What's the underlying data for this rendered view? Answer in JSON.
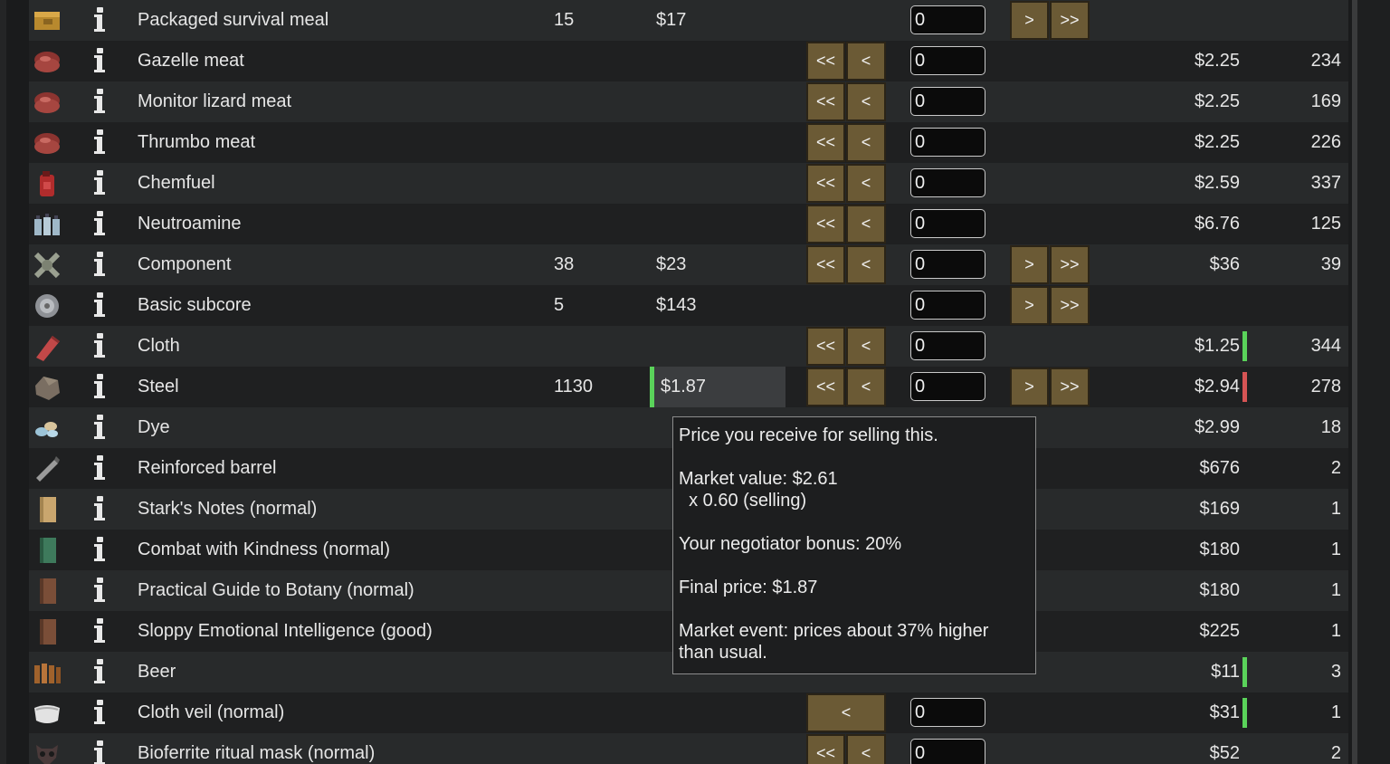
{
  "rows": [
    {
      "name": "Packaged survival meal",
      "icon": "survival-meal-icon",
      "colony_count": "15",
      "colony_price": "$17",
      "qty": "0",
      "buy_buttons": false,
      "sell_buttons": true,
      "trader_price": "",
      "trader_count": "",
      "marker": ""
    },
    {
      "name": "Gazelle meat",
      "icon": "meat-icon",
      "colony_count": "",
      "colony_price": "",
      "qty": "0",
      "buy_buttons": true,
      "sell_buttons": false,
      "trader_price": "$2.25",
      "trader_count": "234",
      "marker": ""
    },
    {
      "name": "Monitor lizard meat",
      "icon": "meat-icon",
      "colony_count": "",
      "colony_price": "",
      "qty": "0",
      "buy_buttons": true,
      "sell_buttons": false,
      "trader_price": "$2.25",
      "trader_count": "169",
      "marker": ""
    },
    {
      "name": "Thrumbo meat",
      "icon": "meat-icon",
      "colony_count": "",
      "colony_price": "",
      "qty": "0",
      "buy_buttons": true,
      "sell_buttons": false,
      "trader_price": "$2.25",
      "trader_count": "226",
      "marker": ""
    },
    {
      "name": "Chemfuel",
      "icon": "chemfuel-icon",
      "colony_count": "",
      "colony_price": "",
      "qty": "0",
      "buy_buttons": true,
      "sell_buttons": false,
      "trader_price": "$2.59",
      "trader_count": "337",
      "marker": ""
    },
    {
      "name": "Neutroamine",
      "icon": "neutroamine-icon",
      "colony_count": "",
      "colony_price": "",
      "qty": "0",
      "buy_buttons": true,
      "sell_buttons": false,
      "trader_price": "$6.76",
      "trader_count": "125",
      "marker": ""
    },
    {
      "name": "Component",
      "icon": "component-icon",
      "colony_count": "38",
      "colony_price": "$23",
      "qty": "0",
      "buy_buttons": true,
      "sell_buttons": true,
      "trader_price": "$36",
      "trader_count": "39",
      "marker": ""
    },
    {
      "name": "Basic subcore",
      "icon": "subcore-icon",
      "colony_count": "5",
      "colony_price": "$143",
      "qty": "0",
      "buy_buttons": false,
      "sell_buttons": true,
      "trader_price": "",
      "trader_count": "",
      "marker": ""
    },
    {
      "name": "Cloth",
      "icon": "cloth-icon",
      "colony_count": "",
      "colony_price": "",
      "qty": "0",
      "buy_buttons": true,
      "sell_buttons": false,
      "trader_price": "$1.25",
      "trader_count": "344",
      "marker": "green"
    },
    {
      "name": "Steel",
      "icon": "steel-icon",
      "colony_count": "1130",
      "colony_price": "$1.87",
      "qty": "0",
      "buy_buttons": true,
      "sell_buttons": true,
      "trader_price": "$2.94",
      "trader_count": "278",
      "marker": "red",
      "highlight": true
    },
    {
      "name": "Dye",
      "icon": "dye-icon",
      "colony_count": "",
      "colony_price": "",
      "qty": "",
      "buy_buttons": false,
      "sell_buttons": false,
      "trader_price": "$2.99",
      "trader_count": "18",
      "marker": ""
    },
    {
      "name": "Reinforced barrel",
      "icon": "barrel-icon",
      "colony_count": "",
      "colony_price": "",
      "qty": "",
      "buy_buttons": false,
      "sell_buttons": false,
      "trader_price": "$676",
      "trader_count": "2",
      "marker": ""
    },
    {
      "name": "Stark's Notes (normal)",
      "icon": "notes-icon",
      "colony_count": "",
      "colony_price": "",
      "qty": "",
      "buy_buttons": false,
      "sell_buttons": false,
      "trader_price": "$169",
      "trader_count": "1",
      "marker": ""
    },
    {
      "name": "Combat with Kindness (normal)",
      "icon": "book-green-icon",
      "colony_count": "",
      "colony_price": "",
      "qty": "",
      "buy_buttons": false,
      "sell_buttons": false,
      "trader_price": "$180",
      "trader_count": "1",
      "marker": ""
    },
    {
      "name": "Practical Guide to Botany (normal)",
      "icon": "book-brown-icon",
      "colony_count": "",
      "colony_price": "",
      "qty": "",
      "buy_buttons": false,
      "sell_buttons": false,
      "trader_price": "$180",
      "trader_count": "1",
      "marker": ""
    },
    {
      "name": "Sloppy Emotional Intelligence (good)",
      "icon": "book-brown-icon",
      "colony_count": "",
      "colony_price": "",
      "qty": "",
      "buy_buttons": false,
      "sell_buttons": false,
      "trader_price": "$225",
      "trader_count": "1",
      "marker": ""
    },
    {
      "name": "Beer",
      "icon": "beer-icon",
      "colony_count": "",
      "colony_price": "",
      "qty": "",
      "buy_buttons": false,
      "sell_buttons": false,
      "trader_price": "$11",
      "trader_count": "3",
      "marker": "green"
    },
    {
      "name": "Cloth veil (normal)",
      "icon": "veil-icon",
      "colony_count": "",
      "colony_price": "",
      "qty": "0",
      "single_buy": true,
      "buy_buttons": false,
      "sell_buttons": false,
      "trader_price": "$31",
      "trader_count": "1",
      "marker": "green"
    },
    {
      "name": "Bioferrite ritual mask (normal)",
      "icon": "mask-icon",
      "colony_count": "",
      "colony_price": "",
      "qty": "0",
      "buy_buttons": true,
      "sell_buttons": false,
      "trader_price": "$52",
      "trader_count": "2",
      "marker": ""
    }
  ],
  "labels": {
    "buy_all": "<<",
    "buy_one": "<",
    "sell_one": ">",
    "sell_all": ">>"
  },
  "tooltip": {
    "line1": "Price you receive for selling this.",
    "line2": "Market value: $2.61",
    "line3": "  x 0.60 (selling)",
    "line4": "Your negotiator bonus: 20%",
    "line5": "Final price: $1.87",
    "line6": "Market event: prices about 37% higher",
    "line7": "than usual."
  },
  "colors": {
    "button": "#6b5a35",
    "good_marker": "#5ad35a",
    "bad_marker": "#d65454"
  }
}
